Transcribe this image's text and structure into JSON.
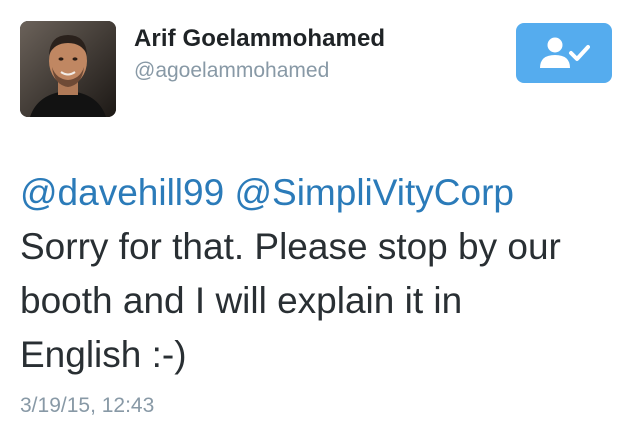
{
  "tweet": {
    "author": {
      "name": "Arif Goelammohamed",
      "screen_name": "@agoelammohamed"
    },
    "follow_button": {
      "state": "following",
      "icon": "user-check-icon",
      "color": "#55acee"
    },
    "mentions": [
      "@davehill99",
      "@SimpliVityCorp"
    ],
    "text_line_1": "Sorry for that. Please stop by our",
    "text_line_2": "booth and I will explain it in",
    "text_line_3": "English :-)",
    "timestamp": "3/19/15, 12:43"
  },
  "colors": {
    "link": "#2b7bb9",
    "secondary_text": "#8899a6",
    "primary_text": "#292f33"
  }
}
